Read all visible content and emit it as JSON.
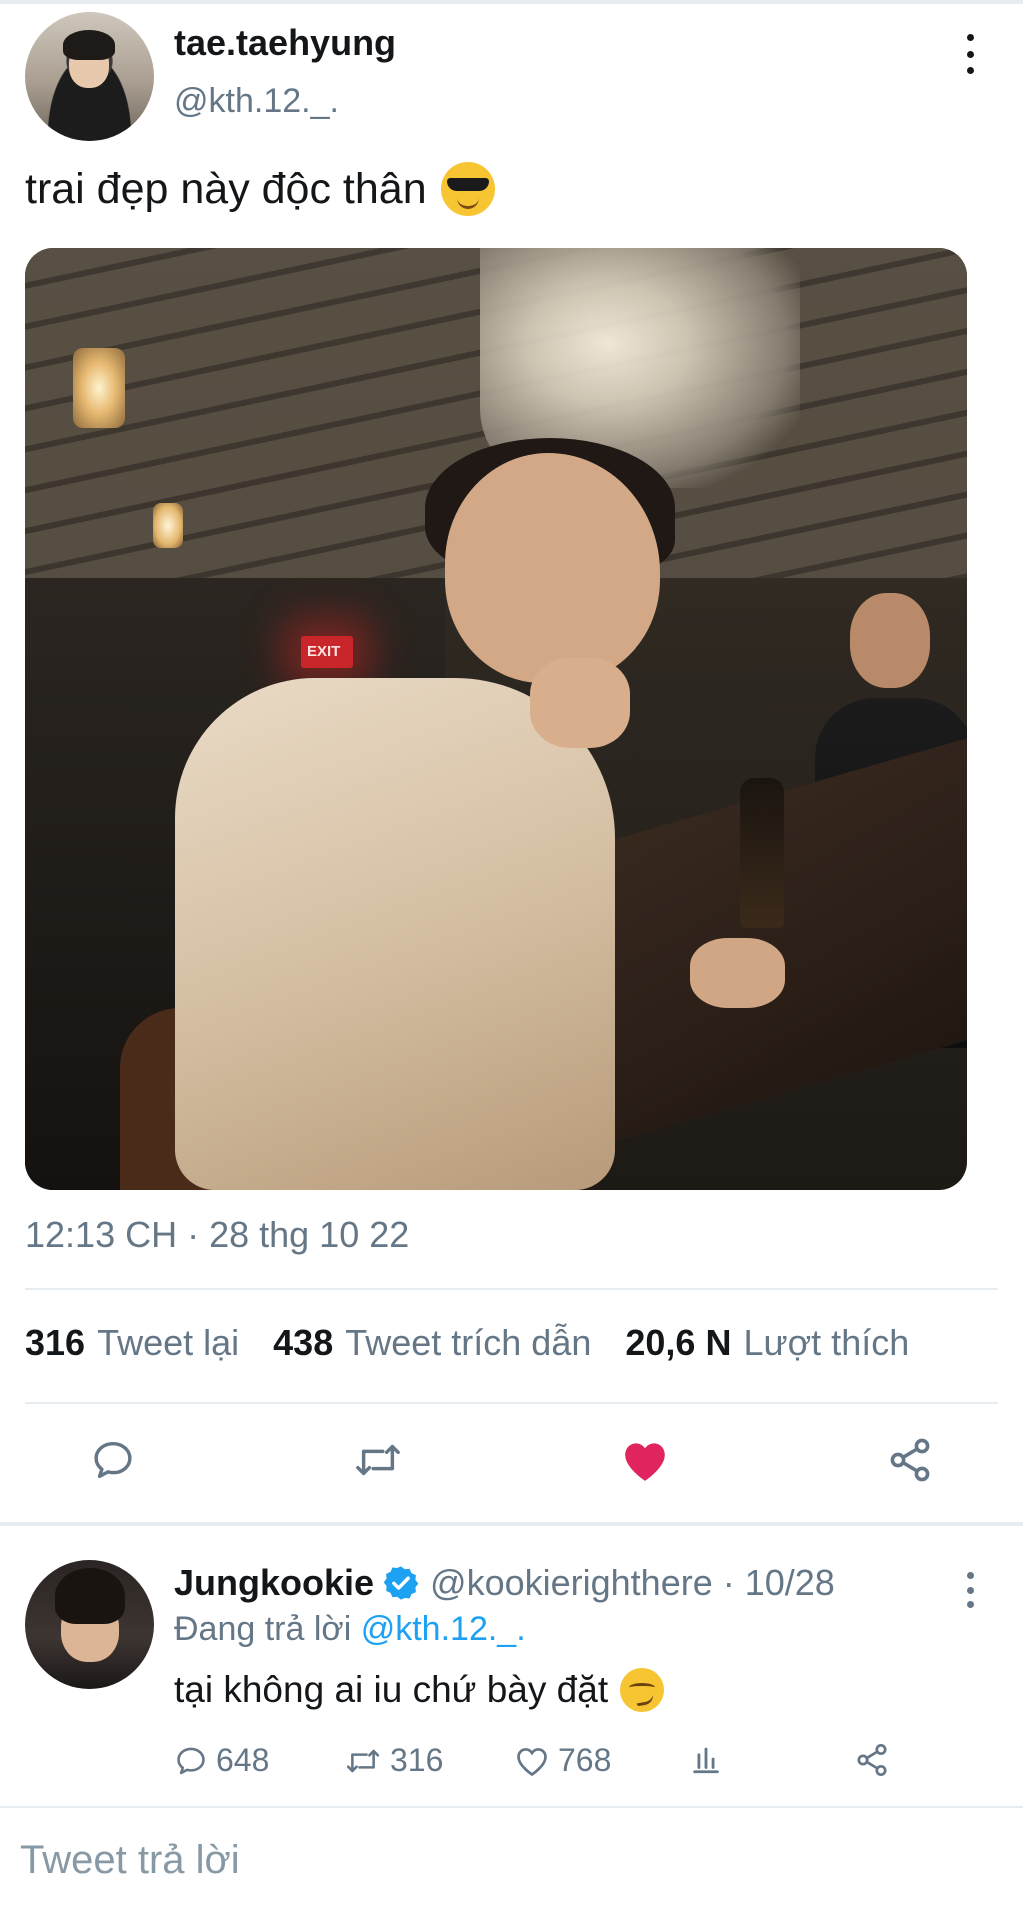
{
  "main_tweet": {
    "display_name": "tae.taehyung",
    "handle": "@kth.12._.",
    "text": "trai đẹp này độc thân",
    "text_emoji": "smiling-face-with-sunglasses",
    "timestamp": "12:13 CH · 28 thg 10 22",
    "stats": [
      {
        "count": "316",
        "label": "Tweet lại"
      },
      {
        "count": "438",
        "label": "Tweet trích dẫn"
      },
      {
        "count": "20,6 N",
        "label": "Lượt thích"
      }
    ],
    "liked": true,
    "actions": [
      "reply-icon",
      "retweet-icon",
      "like-icon",
      "share-icon"
    ],
    "like_color": "#e0245e"
  },
  "reply": {
    "display_name": "Jungkookie",
    "verified": true,
    "handle_date": "@kookierighthere · 10/28",
    "replying_prefix": "Đang trả lời",
    "replying_to": "@kth.12._.",
    "text": "tại không ai iu chứ bày đặt",
    "text_emoji": "smirking-face",
    "counts": {
      "replies": "648",
      "retweets": "316",
      "likes": "768"
    }
  },
  "compose": {
    "placeholder": "Tweet trả lời"
  },
  "colors": {
    "accent": "#1da1f2",
    "secondary_text": "#657786",
    "divider": "#e6ecf0"
  }
}
